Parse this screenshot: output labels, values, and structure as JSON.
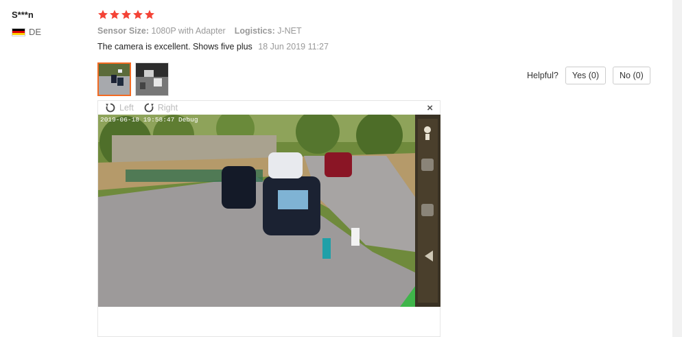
{
  "reviewer": {
    "name": "S***n",
    "country_code": "DE"
  },
  "review": {
    "rating": 5,
    "attributes": [
      {
        "key": "Sensor Size:",
        "value": "1080P with Adapter"
      },
      {
        "key": "Logistics:",
        "value": "J-NET"
      }
    ],
    "comment": "The camera is excellent. Shows five plus",
    "date": "18 Jun 2019 11:27"
  },
  "helpful": {
    "label": "Helpful?",
    "yes_label": "Yes (0)",
    "no_label": "No (0)"
  },
  "viewer": {
    "rotate_left_label": "Left",
    "rotate_right_label": "Right",
    "close_label": "×",
    "photo_overlay_text": "2019-06-18  19:58:47 Debug"
  },
  "colors": {
    "star": "#f44336",
    "accent": "#f36a21"
  }
}
